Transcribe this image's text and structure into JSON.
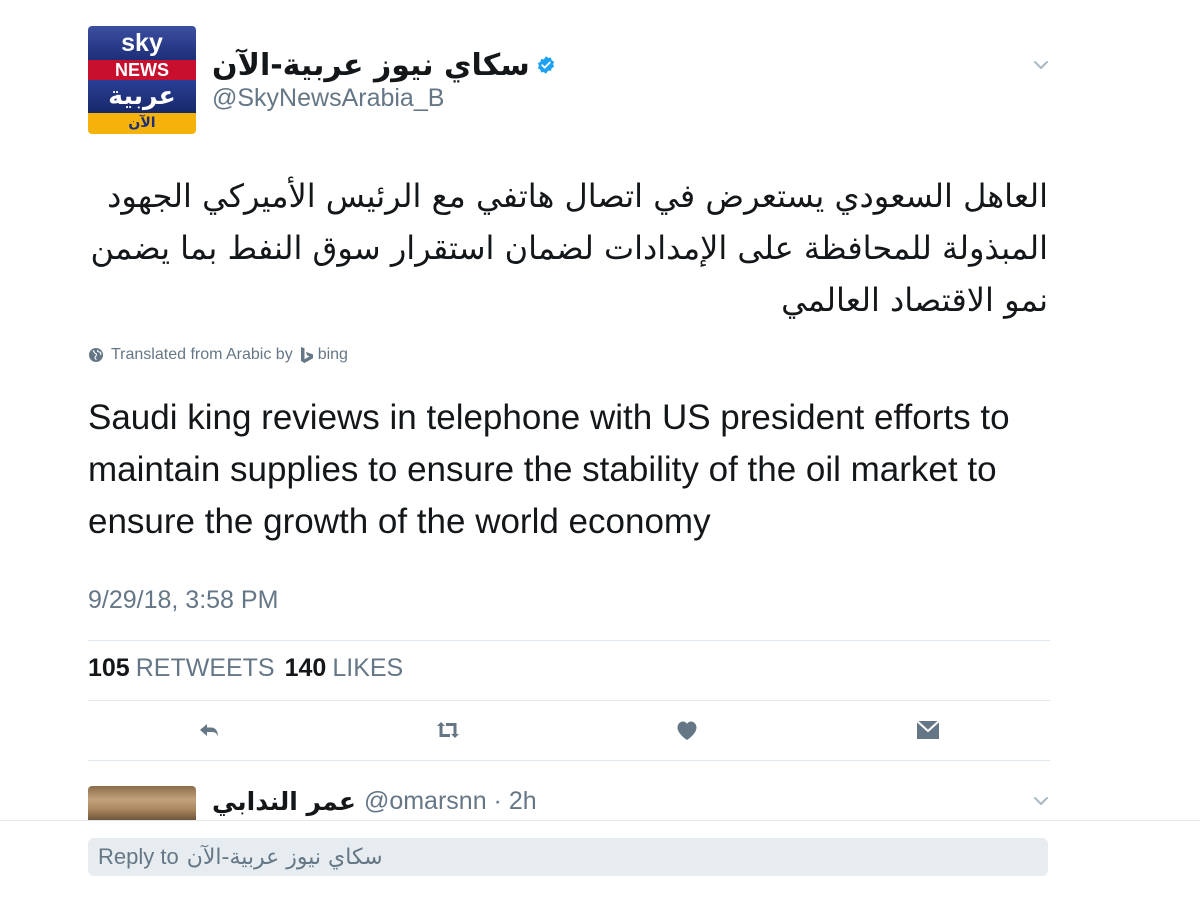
{
  "tweet": {
    "avatar_logo": {
      "line1": "sky",
      "line2": "NEWS",
      "line3": "عربية",
      "line4": "الآن"
    },
    "display_name": "سكاي نيوز عربية-الآن",
    "handle": "@SkyNewsArabia_B",
    "arabic_text": "العاهل السعودي يستعرض في اتصال هاتفي مع الرئيس الأميركي الجهود المبذولة للمحافظة على الإمدادات لضمان استقرار سوق النفط بما يضمن نمو الاقتصاد العالمي",
    "translated_label": "Translated from Arabic by",
    "translator": "bing",
    "translation": "Saudi king reviews in telephone with US president efforts to maintain supplies to ensure the stability of the oil market to ensure the growth of the world economy",
    "timestamp": "9/29/18, 3:58 PM",
    "retweets_count": "105",
    "retweets_label": "RETWEETS",
    "likes_count": "140",
    "likes_label": "LIKES"
  },
  "reply_preview": {
    "name": "عمر الندابي",
    "handle_time": "@omarsnn · 2h"
  },
  "reply_bar": {
    "prefix": "Reply to",
    "name": "سكاي نيوز عربية-الآن"
  },
  "icons": {
    "verified": "verified-badge-icon",
    "chevron": "chevron-down-icon",
    "globe": "globe-icon",
    "bing": "bing-logo-icon",
    "reply": "reply-icon",
    "retweet": "retweet-icon",
    "like": "heart-icon",
    "dm": "envelope-icon"
  },
  "colors": {
    "accent": "#1da1f2",
    "muted": "#657786",
    "text": "#14171a",
    "divider": "#e1e8ed",
    "reply_bar_bg": "#e6ecf0"
  }
}
